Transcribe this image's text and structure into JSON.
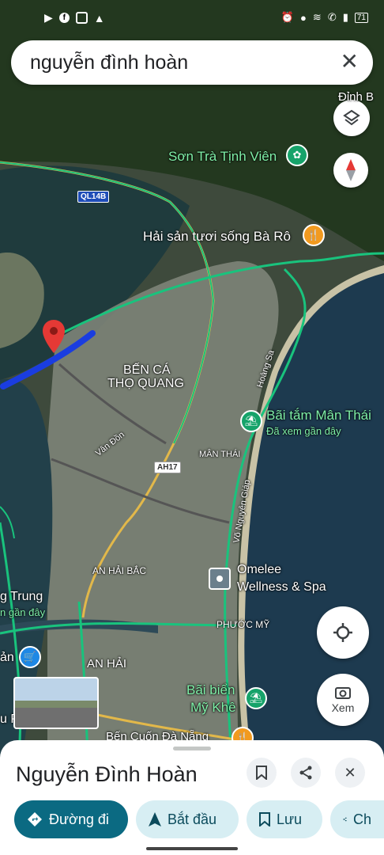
{
  "status_bar": {
    "left_icons": [
      "video-icon",
      "facebook-icon",
      "instagram-icon",
      "warning-icon"
    ],
    "right_icons": [
      "alarm-icon",
      "location-icon",
      "wifi-icon",
      "call-icon",
      "signal-icon",
      "battery-icon"
    ],
    "battery": "71"
  },
  "search": {
    "query": "nguyễn đình hoàn",
    "clear_icon": "close-icon"
  },
  "map": {
    "labels": {
      "dinh_b": "Đỉnh B",
      "son_tra": "Sơn Trà Tịnh Viên",
      "hai_san": "Hải sản tươi sống Bà Rô",
      "ben_ca_1": "BẾN CÁ",
      "ben_ca_2": "THỌ QUANG",
      "bai_tam": "Bãi tắm Mân Thái",
      "bai_tam_sub": "Đã xem gần đây",
      "man_thai": "MÂN THÁI",
      "van_don": "Vân Đồn",
      "hoang_sa": "Hoàng Sa",
      "vo_nguyen_giap": "Võ Nguyên Giáp",
      "an_hai_bac": "AN HẢI BẮC",
      "omelee_1": "Omelee",
      "omelee_2": "Wellness & Spa",
      "phuoc_my": "PHƯỚC MỸ",
      "an_hai": "AN HẢI",
      "bai_bien_1": "Bãi biển",
      "bai_bien_2": "Mỹ Khê",
      "ben_cuon": "Bến Cuốn Đà Nẵng",
      "g_trung": "g Trung",
      "gan_day": "n gần đây",
      "an": "ản",
      "u": "u Ph",
      "ql14b": "QL14B",
      "ah17": "AH17"
    }
  },
  "controls": {
    "layers_icon": "layers-icon",
    "compass_icon": "compass-icon",
    "locate_icon": "my-location-icon",
    "xem_label": "Xem"
  },
  "sheet": {
    "title": "Nguyễn Đình Hoàn",
    "actions": [
      {
        "icon": "directions-icon",
        "label": "Đường đi"
      },
      {
        "icon": "navigation-icon",
        "label": "Bắt đầu"
      },
      {
        "icon": "bookmark-icon",
        "label": "Lưu"
      },
      {
        "icon": "share-icon",
        "label": "Ch"
      }
    ]
  },
  "colors": {
    "primary": "#0b6a82",
    "chip_bg": "#d7eef3",
    "route": "#1a3de0",
    "pin": "#e53935",
    "road_green": "#19c37d"
  }
}
